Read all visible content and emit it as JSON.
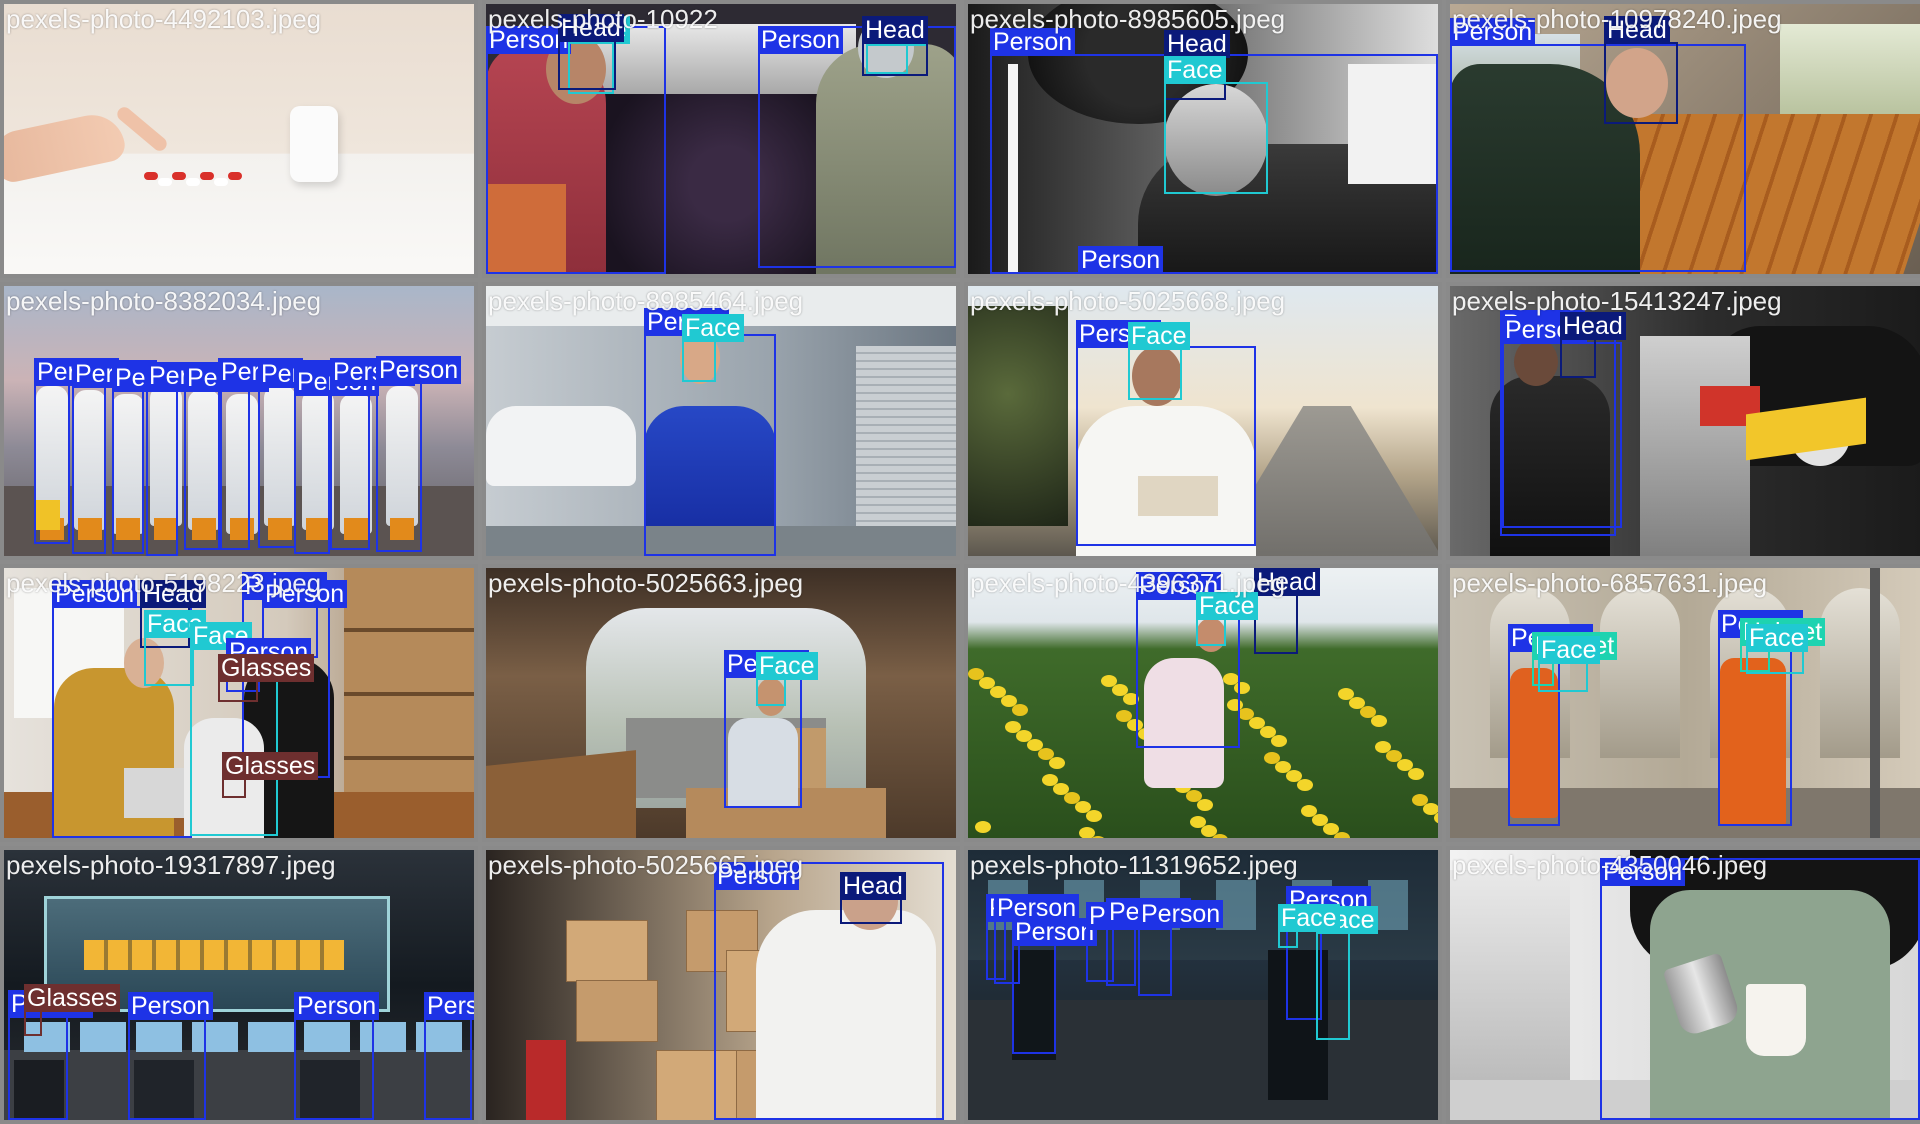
{
  "class_colors": {
    "Person": "#1e33e6",
    "Head": "#0b1a7a",
    "Face": "#20c9d2",
    "Glasses": "#6e2f2f",
    "Helmet": "#1ed3b0"
  },
  "label_text_colors": {
    "Person": "#ffffff",
    "Head": "#ffffff",
    "Face": "#ffffff",
    "Glasses": "#ffffff",
    "Helmet": "#ffffff"
  },
  "tiles": [
    {
      "file": "pexels-photo-4492103.jpeg",
      "scene": "pills",
      "detections": []
    },
    {
      "file": "pexels-photo-10922",
      "scene": "grapes",
      "detections": [
        {
          "cls": "Person"
        },
        {
          "cls": "Face"
        },
        {
          "cls": "Head"
        },
        {
          "cls": "Person"
        },
        {
          "cls": "Face"
        },
        {
          "cls": "Head"
        }
      ]
    },
    {
      "file": "pexels-photo-8985605.jpeg",
      "scene": "bw",
      "detections": [
        {
          "cls": "Person"
        },
        {
          "cls": "Head"
        },
        {
          "cls": "Face"
        },
        {
          "cls": "Person"
        }
      ]
    },
    {
      "file": "pexels-photo-10978240.jpeg",
      "scene": "bakery",
      "detections": [
        {
          "cls": "Person"
        },
        {
          "cls": "Head"
        }
      ]
    },
    {
      "file": "pexels-photo-8382034.jpeg",
      "scene": "hazmat",
      "detections": [
        {
          "cls": "Person"
        },
        {
          "cls": "Person"
        },
        {
          "cls": "Person"
        },
        {
          "cls": "Person"
        },
        {
          "cls": "Person"
        },
        {
          "cls": "Person"
        },
        {
          "cls": "Person"
        },
        {
          "cls": "Person"
        },
        {
          "cls": "Person"
        },
        {
          "cls": "Person"
        },
        {
          "cls": "Person"
        }
      ]
    },
    {
      "file": "pexels-photo-8985464.jpeg",
      "scene": "mechanic",
      "detections": [
        {
          "cls": "Person"
        },
        {
          "cls": "Face"
        }
      ]
    },
    {
      "file": "pexels-photo-5025668.jpeg",
      "scene": "sunset",
      "detections": [
        {
          "cls": "Person"
        },
        {
          "cls": "Face"
        }
      ]
    },
    {
      "file": "pexels-photo-15413247.jpeg",
      "scene": "garage",
      "detections": [
        {
          "cls": "Person"
        },
        {
          "cls": "Person"
        },
        {
          "cls": "Head"
        }
      ]
    },
    {
      "file": "pexels-photo-5198223.jpeg",
      "scene": "office",
      "detections": [
        {
          "cls": "Person"
        },
        {
          "cls": "Head"
        },
        {
          "cls": "Face"
        },
        {
          "cls": "Person"
        },
        {
          "cls": "Person"
        },
        {
          "cls": "Face"
        },
        {
          "cls": "Person"
        },
        {
          "cls": "Glasses"
        },
        {
          "cls": "Glasses"
        }
      ]
    },
    {
      "file": "pexels-photo-5025663.jpeg",
      "scene": "van",
      "detections": [
        {
          "cls": "Person"
        },
        {
          "cls": "Face"
        }
      ]
    },
    {
      "file": "pexels-photo-4396371.jpeg",
      "scene": "flowers",
      "detections": [
        {
          "cls": "Person"
        },
        {
          "cls": "Head"
        },
        {
          "cls": "Face"
        }
      ]
    },
    {
      "file": "pexels-photo-6857631.jpeg",
      "scene": "street",
      "detections": [
        {
          "cls": "Person"
        },
        {
          "cls": "Helmet"
        },
        {
          "cls": "Face"
        },
        {
          "cls": "Person"
        },
        {
          "cls": "Helmet"
        },
        {
          "cls": "Face"
        }
      ]
    },
    {
      "file": "pexels-photo-19317897.jpeg",
      "scene": "control",
      "detections": [
        {
          "cls": "Person"
        },
        {
          "cls": "Glasses"
        },
        {
          "cls": "Person"
        },
        {
          "cls": "Person"
        },
        {
          "cls": "Person"
        }
      ]
    },
    {
      "file": "pexels-photo-5025665.jpeg",
      "scene": "boxes",
      "detections": [
        {
          "cls": "Person"
        },
        {
          "cls": "Head"
        }
      ]
    },
    {
      "file": "pexels-photo-11319652.jpeg",
      "scene": "night",
      "detections": [
        {
          "cls": "Person"
        },
        {
          "cls": "Person"
        },
        {
          "cls": "Person"
        },
        {
          "cls": "Person"
        },
        {
          "cls": "Person"
        },
        {
          "cls": "Person"
        },
        {
          "cls": "Person"
        },
        {
          "cls": "Face"
        },
        {
          "cls": "Face"
        }
      ]
    },
    {
      "file": "pexels-photo-4350046.jpeg",
      "scene": "barista",
      "detections": [
        {
          "cls": "Person"
        }
      ]
    }
  ]
}
